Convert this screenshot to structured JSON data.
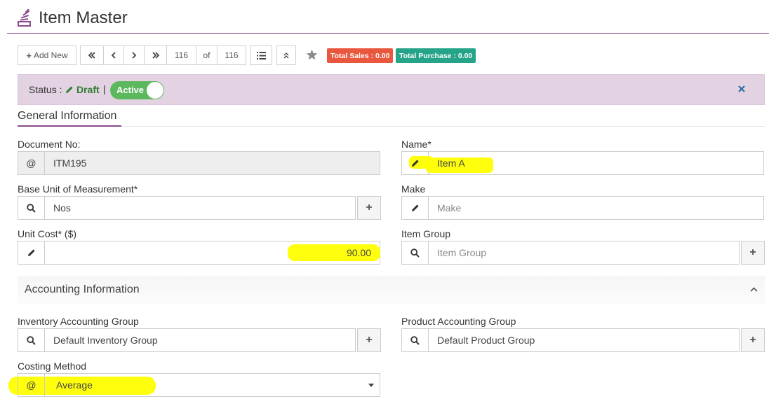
{
  "page": {
    "title": "Item Master"
  },
  "toolbar": {
    "add_new": "Add New",
    "current_record": "116",
    "of_label": "of",
    "total_records": "116",
    "total_sales": "Total Sales : 0.00",
    "total_purchase": "Total Purchase : 0.00",
    "sales_color": "#e9573f",
    "purchase_color": "#26a48a"
  },
  "status": {
    "label": "Status :",
    "draft": "Draft",
    "separator": "|",
    "active_label": "Active",
    "active_on": true
  },
  "sections": {
    "general": "General Information",
    "accounting": "Accounting Information"
  },
  "fields": {
    "document_no": {
      "label": "Document No:",
      "value": "ITM195"
    },
    "name": {
      "label": "Name*",
      "value": "Item A"
    },
    "base_uom": {
      "label": "Base Unit of Measurement*",
      "value": "Nos"
    },
    "make": {
      "label": "Make",
      "placeholder": "Make"
    },
    "unit_cost": {
      "label": "Unit Cost* ($)",
      "value": "90.00"
    },
    "item_group": {
      "label": "Item Group",
      "placeholder": "Item Group"
    },
    "inventory_group": {
      "label": "Inventory Accounting Group",
      "value": "Default Inventory Group"
    },
    "product_group": {
      "label": "Product Accounting Group",
      "value": "Default Product Group"
    },
    "costing_method": {
      "label": "Costing Method",
      "value": "Average"
    }
  },
  "icons": {
    "at": "@",
    "plus": "+"
  }
}
